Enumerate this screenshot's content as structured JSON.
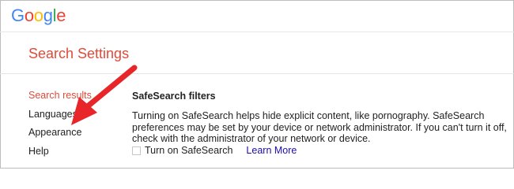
{
  "header": {
    "logo": {
      "letters": [
        {
          "char": "G",
          "color": "#4285f4"
        },
        {
          "char": "o",
          "color": "#ea4335"
        },
        {
          "char": "o",
          "color": "#fbbc05"
        },
        {
          "char": "g",
          "color": "#4285f4"
        },
        {
          "char": "l",
          "color": "#34a853"
        },
        {
          "char": "e",
          "color": "#ea4335"
        }
      ]
    }
  },
  "page": {
    "title": "Search Settings"
  },
  "sidebar": {
    "items": [
      {
        "label": "Search results",
        "active": true
      },
      {
        "label": "Languages",
        "active": false
      },
      {
        "label": "Appearance",
        "active": false
      },
      {
        "label": "Help",
        "active": false
      }
    ]
  },
  "main": {
    "section_title": "SafeSearch filters",
    "description": "Turning on SafeSearch helps hide explicit content, like pornography. SafeSearch preferences may be set by your device or network administrator. If you can't turn it off, check with the administrator of your network or device.",
    "checkbox_label": "Turn on SafeSearch",
    "checkbox_checked": false,
    "learn_more": "Learn More"
  },
  "colors": {
    "accent_red": "#dd4b39",
    "link_blue": "#1a0dab",
    "annotation_arrow": "#e8262a"
  }
}
